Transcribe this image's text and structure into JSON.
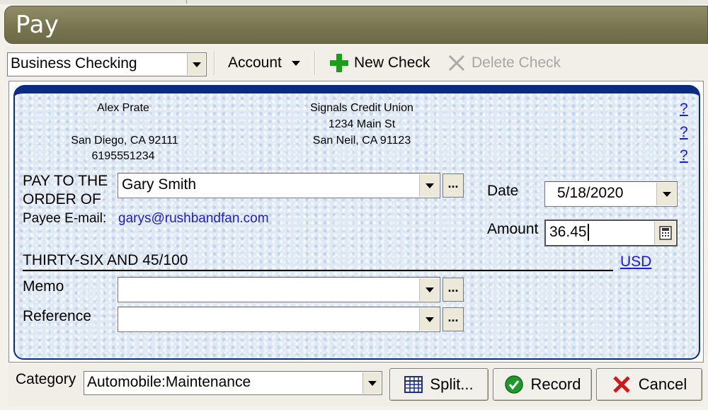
{
  "window": {
    "title": "Pay"
  },
  "toolbar": {
    "account_select": "Business Checking",
    "account_menu": "Account",
    "new_check": "New Check",
    "delete_check": "Delete Check"
  },
  "check": {
    "payer": {
      "name": "Alex Prate",
      "city_line": "San Diego, CA 92111",
      "phone": "6195551234"
    },
    "bank": {
      "name": "Signals Credit Union",
      "street": "1234 Main St",
      "city_line": "San Neil, CA 91123"
    },
    "help_links": [
      "?",
      "?",
      "?"
    ],
    "pay_to_label_1": "PAY TO THE",
    "pay_to_label_2": "ORDER OF",
    "payee": "Gary Smith",
    "payee_email_label": "Payee E-mail:",
    "payee_email": "garys@rushbandfan.com",
    "date_label": "Date",
    "date_value": "5/18/2020",
    "amount_label": "Amount",
    "amount_value": "36.45",
    "amount_words": "THIRTY-SIX AND 45/100",
    "currency": "USD",
    "memo_label": "Memo",
    "memo_value": "",
    "reference_label": "Reference",
    "reference_value": "",
    "ellipsis": "..."
  },
  "footer": {
    "category_label": "Category",
    "category_value": "Automobile:Maintenance",
    "split_button": "Split...",
    "record_button": "Record",
    "cancel_button": "Cancel"
  },
  "colors": {
    "title_bar": "#7a7750",
    "check_border": "#0a2b84",
    "link": "#1a1ae0",
    "new_icon": "#19a019",
    "cancel_icon": "#d01818",
    "record_icon": "#1f9a2a"
  }
}
